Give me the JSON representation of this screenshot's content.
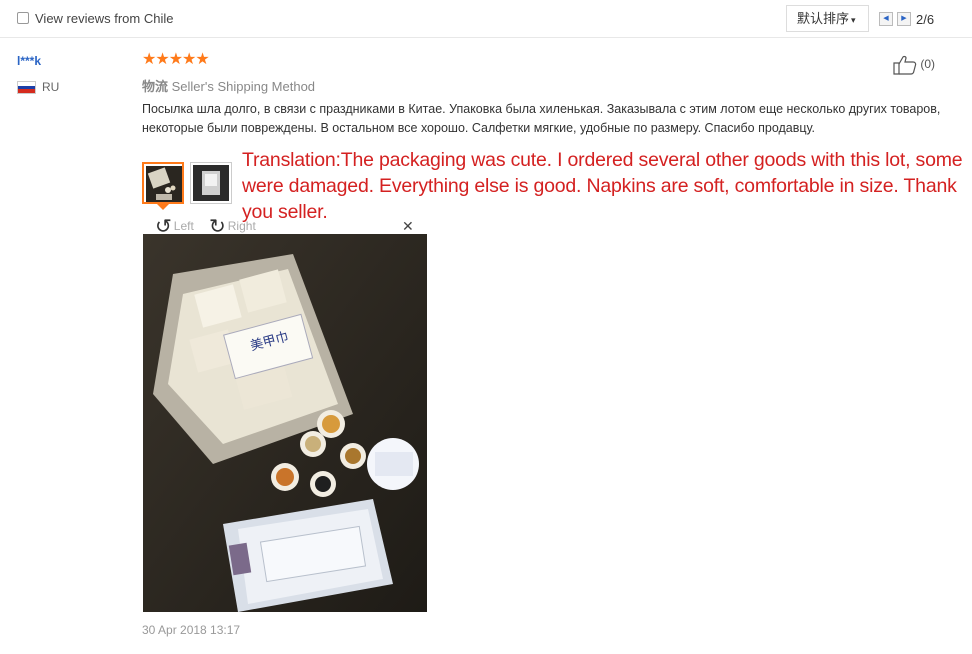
{
  "filter": {
    "label": "View reviews from Chile",
    "checked": false
  },
  "sort": {
    "label": "默认排序",
    "chevron": "chevron-down-icon"
  },
  "pagination": {
    "text": "2/6",
    "prev_icon": "caret-left-icon",
    "next_icon": "caret-right-icon"
  },
  "review": {
    "user": "l***k",
    "country": "RU",
    "flag_colors": [
      "#ffffff",
      "#1c3fa8",
      "#d52b1e"
    ],
    "rating": 5,
    "stars": "★★★★★",
    "shipping_cn": "物流",
    "shipping": " Seller's Shipping Method",
    "helpful_count": "(0)",
    "text": "Посылка шла долго, в связи с праздниками в Китае. Упаковка была хиленькая. Заказывала с этим лотом еще несколько других товаров, некоторые были повреждены. В остальном все хорошо. Салфетки мягкие, удобные по размеру. Спасибо продавцу.",
    "rotate_left": "Left",
    "rotate_right": "Right",
    "close": "✕",
    "date": "30 Apr 2018 13:17"
  },
  "translation": "Translation:The packaging was cute. I ordered several other goods with this lot, some were damaged. Everything else is good. Napkins are soft, comfortable in size. Thank you seller.",
  "colors": {
    "link": "#2a64c5",
    "star": "#ff7a1a",
    "translation": "#d42121",
    "muted": "#999999"
  }
}
